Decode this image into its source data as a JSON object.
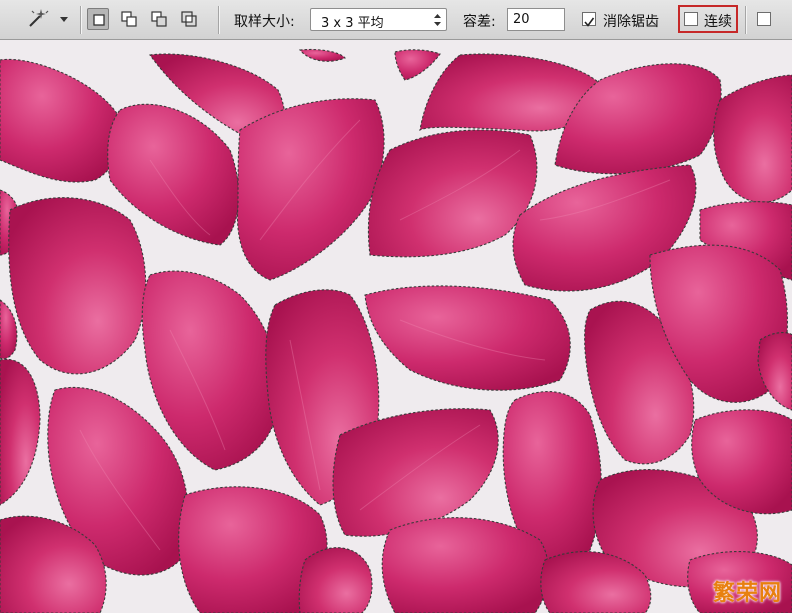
{
  "options_bar": {
    "tool_icon": "magic-wand-icon",
    "selection_modes": [
      {
        "icon": "new-selection-icon",
        "active": true
      },
      {
        "icon": "add-to-selection-icon",
        "active": false
      },
      {
        "icon": "subtract-from-selection-icon",
        "active": false
      },
      {
        "icon": "intersect-selection-icon",
        "active": false
      }
    ],
    "sample_size_label": "取样大小:",
    "sample_size_value": "3 x 3 平均",
    "tolerance_label": "容差:",
    "tolerance_value": "20",
    "antialias_label": "消除锯齿",
    "antialias_checked": true,
    "contiguous_label": "连续",
    "contiguous_checked": false
  },
  "watermark": "繁荣网",
  "colors": {
    "petal_main": "#c81f67",
    "petal_light": "#e2578f",
    "background": "#efebee",
    "highlight_box": "#c62828",
    "watermark": "#e8800f"
  }
}
